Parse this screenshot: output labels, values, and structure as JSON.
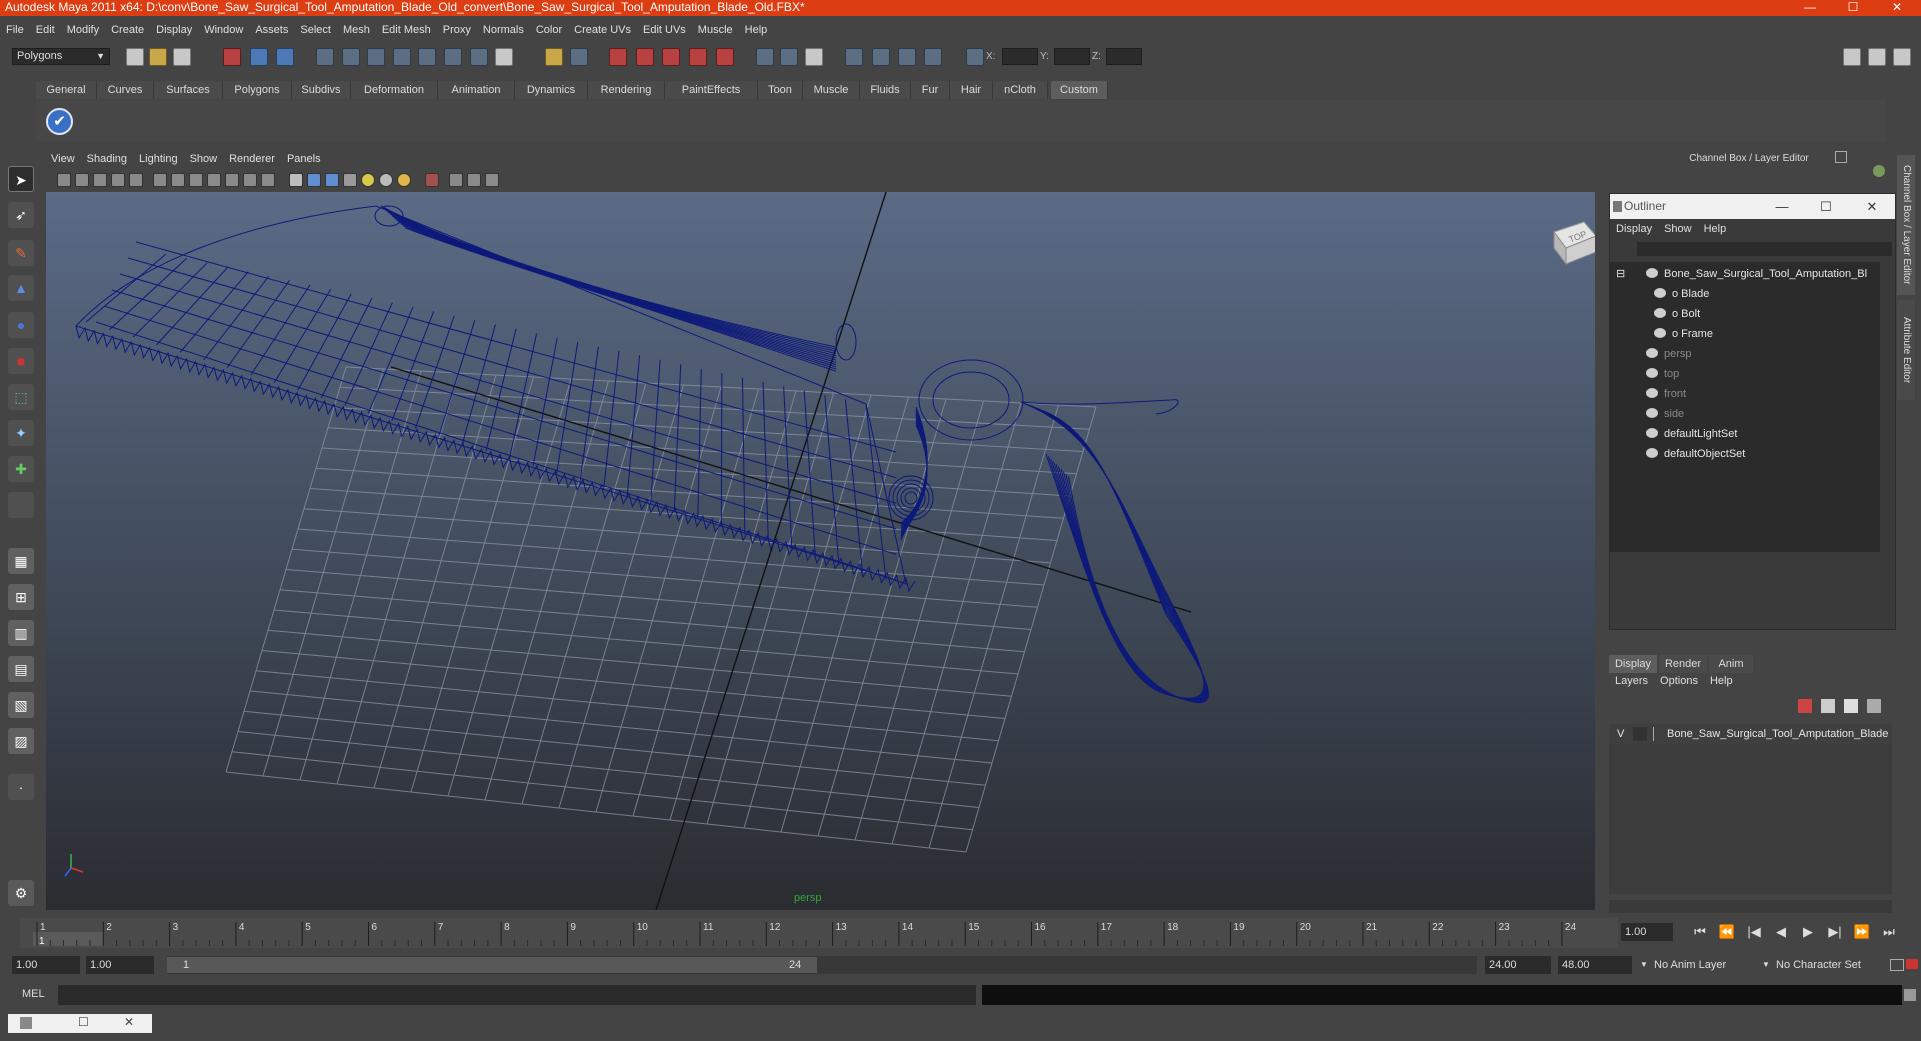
{
  "window": {
    "title": "Autodesk Maya 2011 x64: D:\\conv\\Bone_Saw_Surgical_Tool_Amputation_Blade_Old_convert\\Bone_Saw_Surgical_Tool_Amputation_Blade_Old.FBX*",
    "minimize": "—",
    "maximize": "☐",
    "close": "✕"
  },
  "menubar": [
    "File",
    "Edit",
    "Modify",
    "Create",
    "Display",
    "Window",
    "Assets",
    "Select",
    "Mesh",
    "Edit Mesh",
    "Proxy",
    "Normals",
    "Color",
    "Create UVs",
    "Edit UVs",
    "Muscle",
    "Help"
  ],
  "toolbar": {
    "mode_select": "Polygons",
    "x_label": "X:",
    "y_label": "Y:",
    "z_label": "Z:"
  },
  "shelf": {
    "tabs": [
      "General",
      "Curves",
      "Surfaces",
      "Polygons",
      "Subdivs",
      "Deformation",
      "Animation",
      "Dynamics",
      "Rendering",
      "PaintEffects",
      "Toon",
      "Muscle",
      "Fluids",
      "Fur",
      "Hair",
      "nCloth",
      "Custom"
    ],
    "active_tab": "Custom",
    "checkmark": "✔"
  },
  "viewport": {
    "menu": [
      "View",
      "Shading",
      "Lighting",
      "Show",
      "Renderer",
      "Panels"
    ],
    "camera_label": "persp",
    "viewcube_label": "TOP",
    "wireframe_color": "#0d1a7a"
  },
  "channel_box": {
    "title": "Channel Box / Layer Editor"
  },
  "side_tabs": {
    "channel": "Channel Box / Layer Editor",
    "attribute": "Attribute Editor"
  },
  "outliner": {
    "title": "Outliner",
    "menu": [
      "Display",
      "Show",
      "Help"
    ],
    "items": [
      {
        "label": "Bone_Saw_Surgical_Tool_Amputation_Bl",
        "indent": 0,
        "dim": false
      },
      {
        "label": "o Blade",
        "indent": 1,
        "dim": false
      },
      {
        "label": "o Bolt",
        "indent": 1,
        "dim": false
      },
      {
        "label": "o Frame",
        "indent": 1,
        "dim": false
      },
      {
        "label": "persp",
        "indent": 0,
        "dim": true
      },
      {
        "label": "top",
        "indent": 0,
        "dim": true
      },
      {
        "label": "front",
        "indent": 0,
        "dim": true
      },
      {
        "label": "side",
        "indent": 0,
        "dim": true
      },
      {
        "label": "defaultLightSet",
        "indent": 0,
        "dim": false
      },
      {
        "label": "defaultObjectSet",
        "indent": 0,
        "dim": false
      }
    ]
  },
  "layer_editor": {
    "tabs": [
      "Display",
      "Render",
      "Anim"
    ],
    "active_tab": "Display",
    "menu": [
      "Layers",
      "Options",
      "Help"
    ],
    "layer": {
      "visible": "V",
      "name": "Bone_Saw_Surgical_Tool_Amputation_Blade"
    }
  },
  "timeline": {
    "ticks": [
      "1",
      "2",
      "3",
      "4",
      "5",
      "6",
      "7",
      "8",
      "9",
      "10",
      "11",
      "12",
      "13",
      "14",
      "15",
      "16",
      "17",
      "18",
      "19",
      "20",
      "21",
      "22",
      "23",
      "24"
    ],
    "current_marker": "1",
    "current_frame": "1.00"
  },
  "playback": [
    "⏮",
    "⏪",
    "|◀",
    "◀",
    "▶",
    "▶|",
    "⏩",
    "⏭"
  ],
  "range": {
    "start": "1.00",
    "start_2": "1.00",
    "handle_start": "1",
    "handle_end": "24",
    "end": "24.00",
    "end_2": "48.00",
    "anim_layer": "No Anim Layer",
    "char_set": "No Character Set"
  },
  "command": {
    "mel_label": "MEL"
  }
}
